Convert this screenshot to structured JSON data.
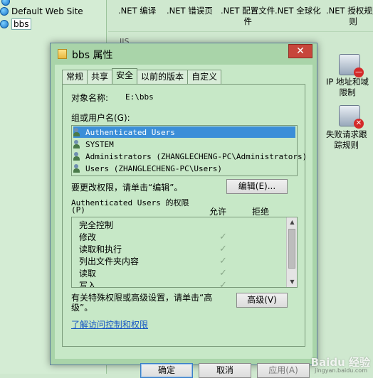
{
  "tree": {
    "items": [
      {
        "label": "Default Web Site"
      },
      {
        "label": "bbs"
      }
    ]
  },
  "iis": {
    "features_top": [
      ".NET 编译",
      ".NET 错误页",
      ".NET 配置文件",
      ".NET 全球化",
      ".NET 授权规则"
    ],
    "features_top_line2": [
      "",
      "",
      "件",
      "",
      "则"
    ],
    "section_label": "IIS",
    "side_features": [
      {
        "line1": "IP 地址和域",
        "line2": "限制"
      },
      {
        "line1": "失败请求跟",
        "line2": "踪规则"
      }
    ]
  },
  "dialog": {
    "title": "bbs 属性",
    "close_label": "✕",
    "tabs": [
      "常规",
      "共享",
      "安全",
      "以前的版本",
      "自定义"
    ],
    "object_name_label": "对象名称:",
    "object_name_value": "E:\\bbs",
    "groups_label": "组或用户名(G):",
    "users": [
      "Authenticated Users",
      "SYSTEM",
      "Administrators (ZHANGLECHENG-PC\\Administrators)",
      "Users (ZHANGLECHENG-PC\\Users)"
    ],
    "change_hint": "要更改权限，请单击“编辑”。",
    "edit_button": "编辑(E)...",
    "perm_title_line1": "Authenticated Users 的权限",
    "perm_title_line2": "(P)",
    "allow_header": "允许",
    "deny_header": "拒绝",
    "permissions": [
      "完全控制",
      "修改",
      "读取和执行",
      "列出文件夹内容",
      "读取",
      "写入"
    ],
    "special_hint_line1": "有关特殊权限或高级设置，请单击“高",
    "special_hint_line2": "级”。",
    "advanced_button": "高级(V)",
    "link_text": "了解访问控制和权限",
    "ok_button": "确定",
    "cancel_button": "取消",
    "apply_button": "应用(A)"
  },
  "watermark": {
    "main": "Baidu 经验",
    "sub": "jingyan.baidu.com"
  }
}
